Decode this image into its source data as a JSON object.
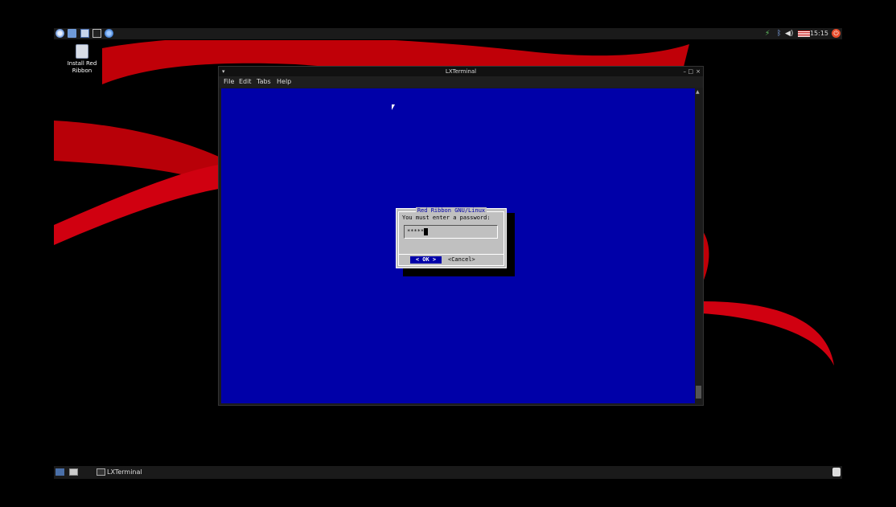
{
  "top_panel": {
    "clock": "15:15",
    "launchers": [
      "menu-icon",
      "file-manager-icon",
      "text-editor-icon",
      "terminal-icon",
      "web-browser-icon"
    ],
    "tray": [
      "network-icon",
      "bluetooth-icon",
      "volume-icon",
      "keyboard-layout-us-flag-icon",
      "logout-icon"
    ]
  },
  "desktop": {
    "icons": [
      {
        "label": "Install Red Ribbon",
        "icon": "installer-icon"
      }
    ]
  },
  "window": {
    "title": "LXTerminal",
    "menu": [
      "File",
      "Edit",
      "Tabs",
      "Help"
    ],
    "controls": {
      "minimize": "–",
      "maximize": "□",
      "close": "×"
    }
  },
  "dialog": {
    "title": "Red Ribbon GNU/Linux",
    "message": "You must enter a password:",
    "password_value": "*****",
    "ok_label": "<  OK  >",
    "cancel_label": "<Cancel>"
  },
  "taskbar": {
    "items": [
      {
        "label": "LXTerminal",
        "icon": "terminal-icon"
      }
    ]
  },
  "colors": {
    "terminal_bg": "#0000a8",
    "dialog_bg": "#c0c0c0",
    "ribbon_red": "#e0000a"
  }
}
